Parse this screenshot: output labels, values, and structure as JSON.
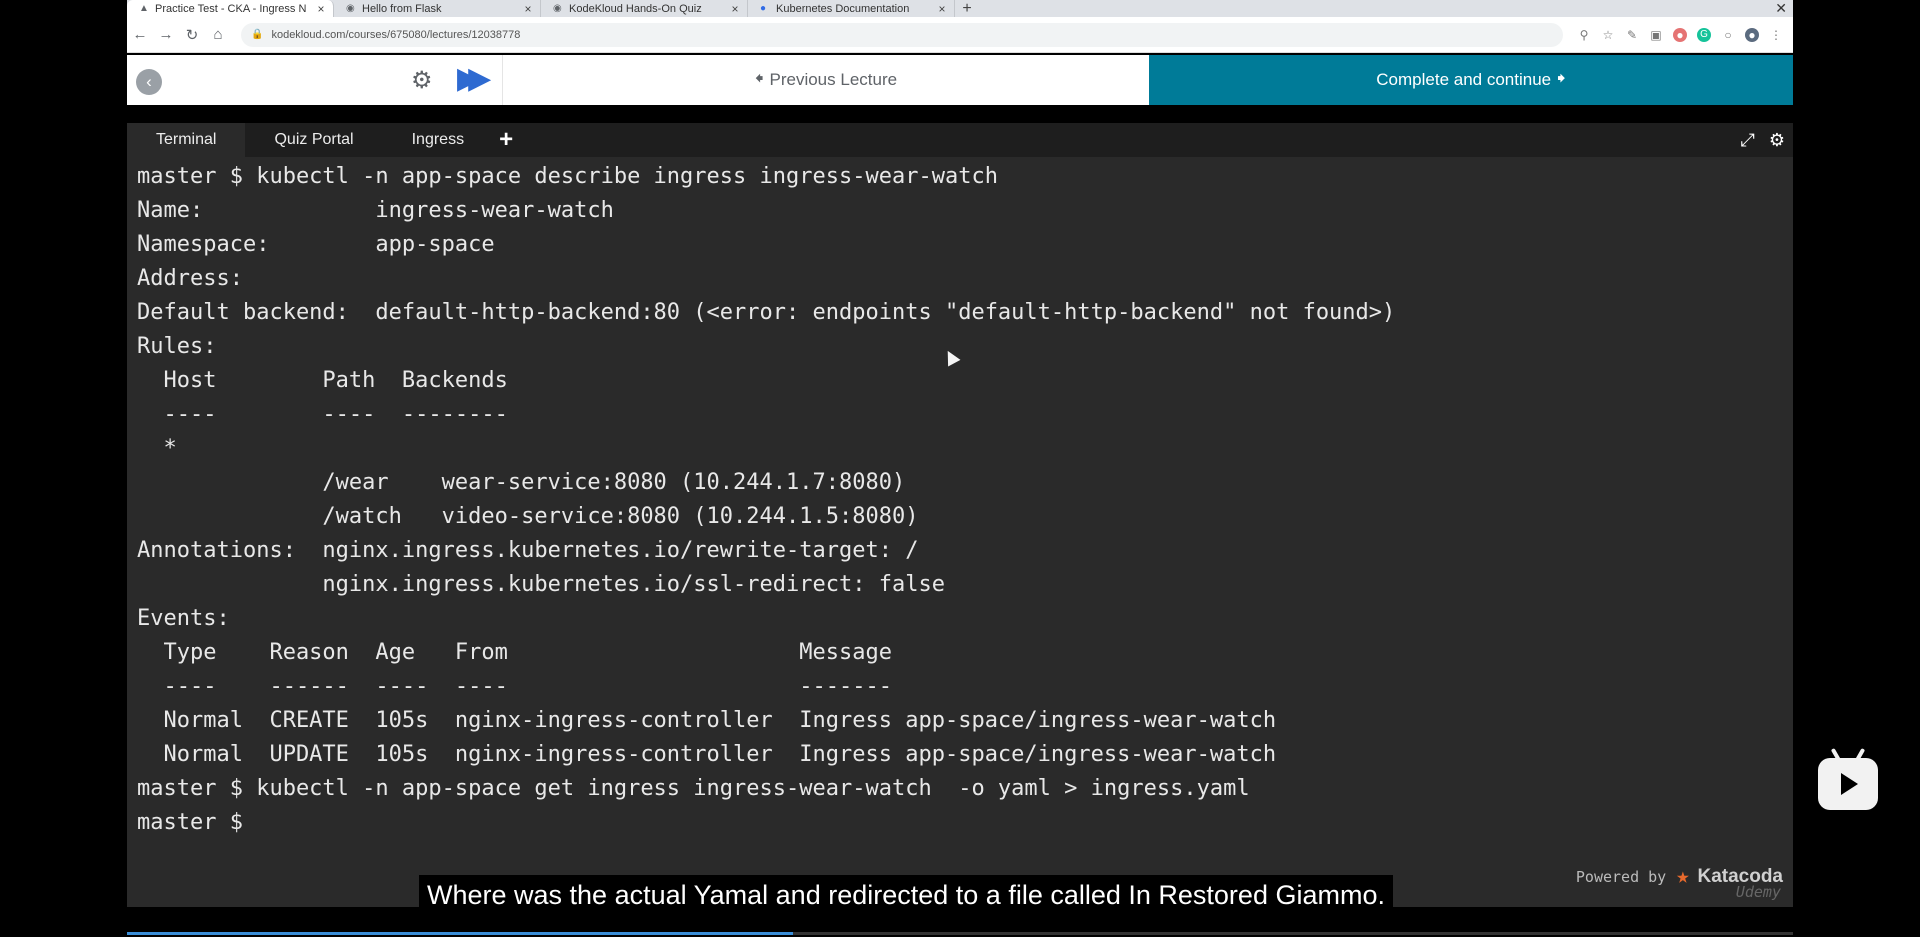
{
  "browser": {
    "tabs": [
      {
        "title": "Practice Test - CKA - Ingress N",
        "icon": "kodekloud-icon",
        "active": true
      },
      {
        "title": "Hello from Flask",
        "icon": "globe-icon",
        "active": false
      },
      {
        "title": "KodeKloud Hands-On Quiz",
        "icon": "globe-icon",
        "active": false
      },
      {
        "title": "Kubernetes Documentation",
        "icon": "kubernetes-icon",
        "active": false
      }
    ],
    "url": "kodekloud.com/courses/675080/lectures/12038778"
  },
  "course_nav": {
    "previous_label": "Previous Lecture",
    "complete_label": "Complete and continue"
  },
  "terminal": {
    "tabs": [
      "Terminal",
      "Quiz Portal",
      "Ingress"
    ],
    "lines": [
      "master $ kubectl -n app-space describe ingress ingress-wear-watch",
      "Name:             ingress-wear-watch",
      "Namespace:        app-space",
      "Address:",
      "Default backend:  default-http-backend:80 (<error: endpoints \"default-http-backend\" not found>)",
      "Rules:",
      "  Host        Path  Backends",
      "  ----        ----  --------",
      "  *",
      "              /wear    wear-service:8080 (10.244.1.7:8080)",
      "              /watch   video-service:8080 (10.244.1.5:8080)",
      "Annotations:  nginx.ingress.kubernetes.io/rewrite-target: /",
      "              nginx.ingress.kubernetes.io/ssl-redirect: false",
      "Events:",
      "  Type    Reason  Age   From                      Message",
      "  ----    ------  ----  ----                      -------",
      "  Normal  CREATE  105s  nginx-ingress-controller  Ingress app-space/ingress-wear-watch",
      "  Normal  UPDATE  105s  nginx-ingress-controller  Ingress app-space/ingress-wear-watch",
      "master $ kubectl -n app-space get ingress ingress-wear-watch  -o yaml > ingress.yaml",
      "master $"
    ]
  },
  "powered_by": {
    "label": "Powered by",
    "brand": "Katacoda"
  },
  "caption": "Where was the actual Yamal and redirected to a file called In Restored Giammo.",
  "watermark": "Udemy",
  "video_progress": 0.4,
  "colors": {
    "complete_button": "#007b98",
    "terminal_bg": "#2a2a2a",
    "autoplay": "#2e6ad1"
  }
}
